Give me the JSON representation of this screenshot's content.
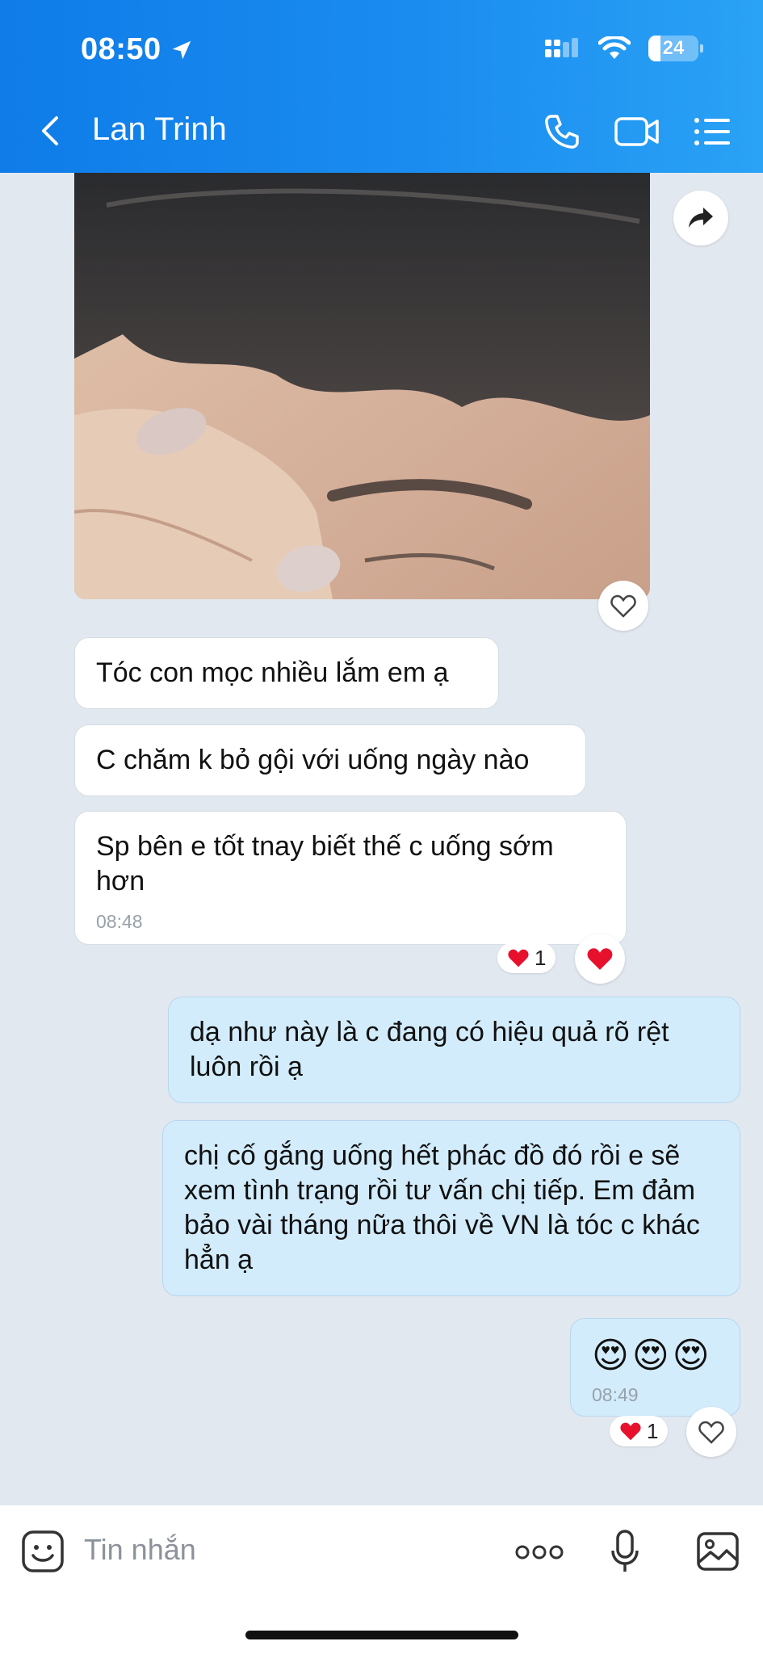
{
  "status_bar": {
    "time": "08:50",
    "battery": "24"
  },
  "header": {
    "contact_name": "Lan Trinh"
  },
  "messages": [
    {
      "dir": "in",
      "text": "Tóc con mọc nhiều lắm em ạ"
    },
    {
      "dir": "in",
      "text": "C chăm k bỏ gội với uống ngày nào"
    },
    {
      "dir": "in",
      "text": "Sp bên e tốt tnay biết thế c uống sớm hơn",
      "time": "08:48",
      "reaction_count": "1"
    },
    {
      "dir": "out",
      "text": "dạ như này là c đang có hiệu quả rõ rệt luôn rồi ạ"
    },
    {
      "dir": "out",
      "text": "chị cố gắng uống hết phác đồ đó rồi e sẽ xem tình trạng  rồi tư vấn chị tiếp. Em đảm bảo vài tháng nữa thôi về VN là tóc c khác hẳn ạ"
    },
    {
      "dir": "out",
      "text": "😍😍😍",
      "time": "08:49",
      "reaction_count": "1"
    }
  ],
  "composer": {
    "placeholder": "Tin nhắn"
  },
  "icons": {
    "back": "chevron-left-icon",
    "call": "phone-icon",
    "video": "video-camera-icon",
    "menu": "list-menu-icon",
    "forward": "share-arrow-icon",
    "react": "heart-icon",
    "sticker": "sticker-icon",
    "more": "more-dots-icon",
    "mic": "microphone-icon",
    "image": "image-icon"
  },
  "colors": {
    "header": "#1a8cf0",
    "bubble_out": "#d3ecfc",
    "bubble_in": "#ffffff",
    "heart": "#e8112d"
  }
}
